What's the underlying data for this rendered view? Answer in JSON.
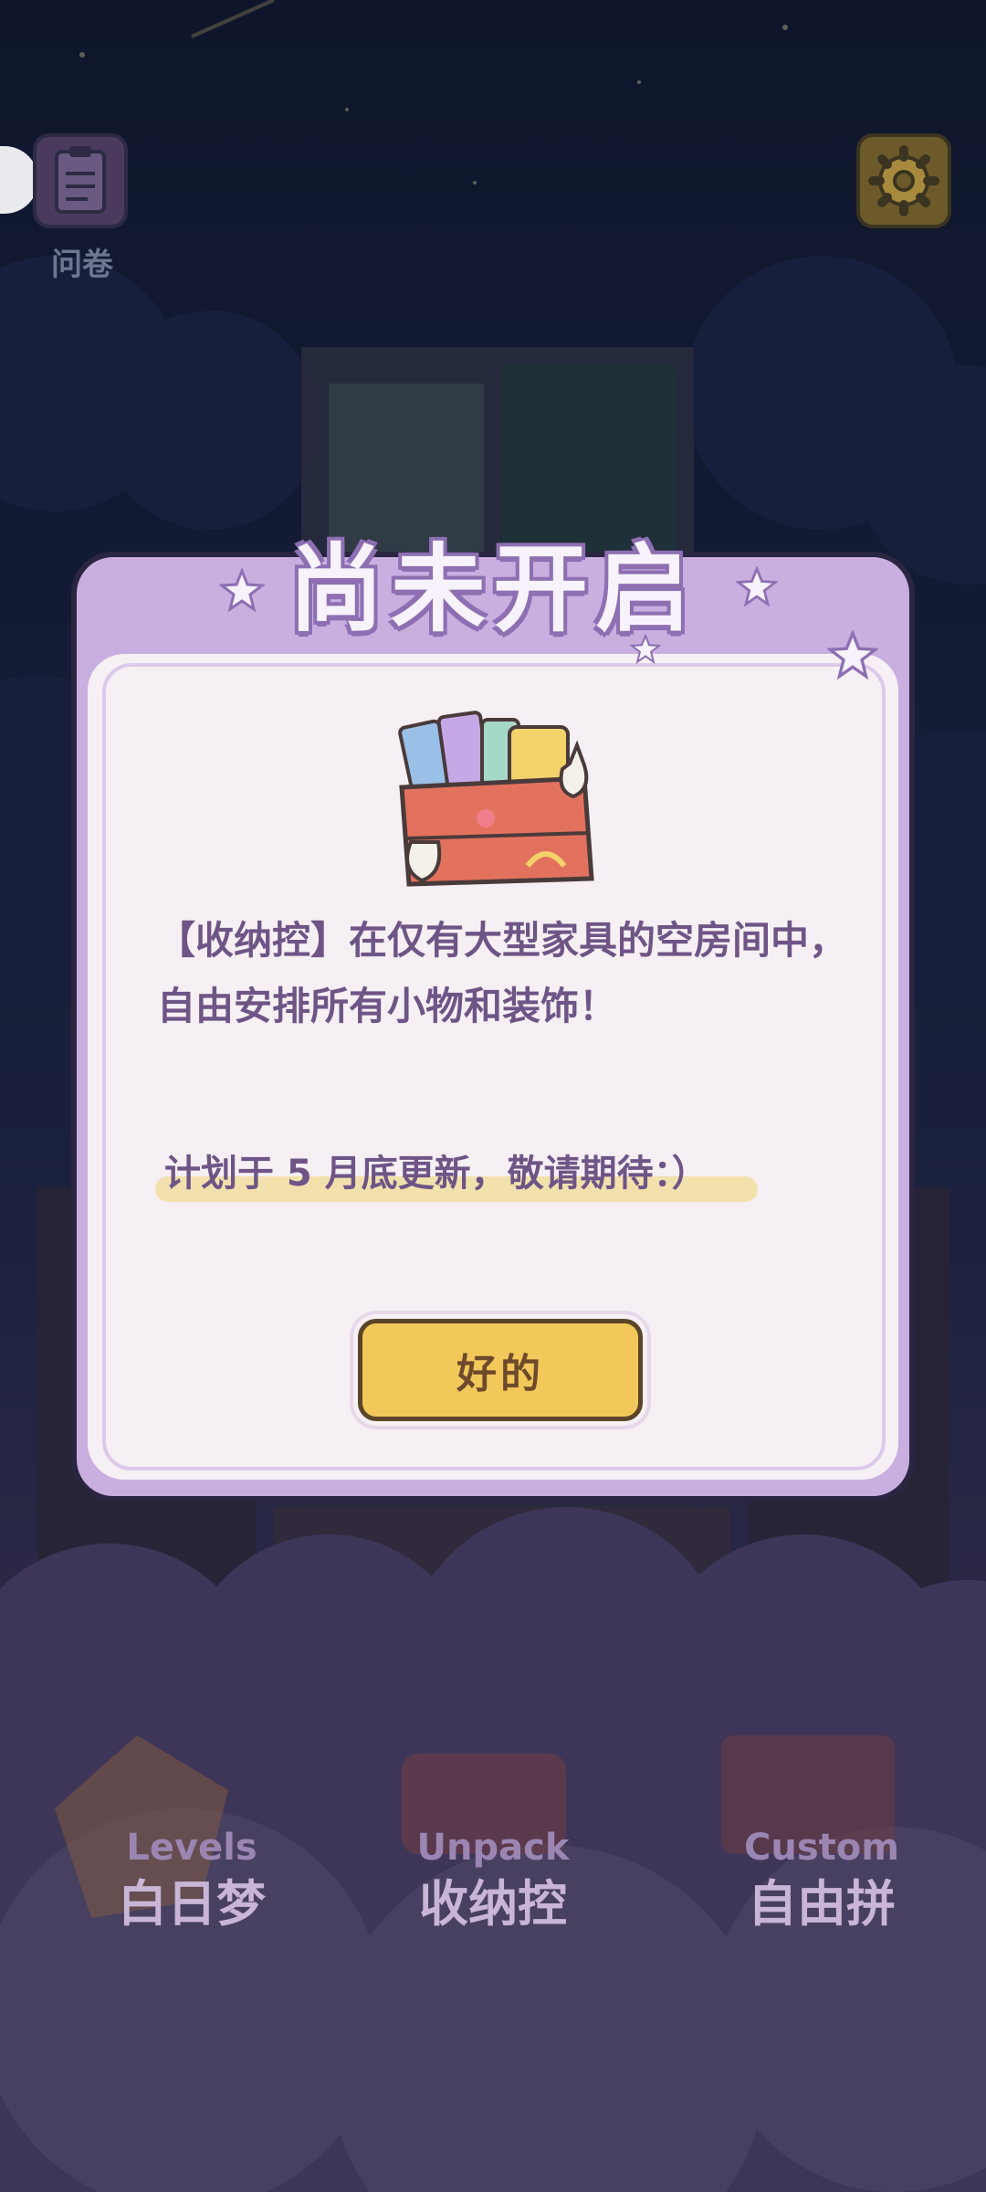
{
  "header": {
    "survey_label": "问卷",
    "survey_icon": "clipboard-icon",
    "settings_icon": "gear-icon"
  },
  "dialog": {
    "title": "尚未开启",
    "description": "【收纳控】在仅有大型家具的空房间中，自由安排所有小物和装饰！",
    "plan": "计划于 5 月底更新，敬请期待：）",
    "ok_label": "好的",
    "illustration": "storage-box-books"
  },
  "modes": [
    {
      "en": "Levels",
      "zh": "白日梦"
    },
    {
      "en": "Unpack",
      "zh": "收纳控"
    },
    {
      "en": "Custom",
      "zh": "自由拼"
    }
  ],
  "colors": {
    "dialog_frame": "#c9aee0",
    "dialog_body": "#f6f0f4",
    "text": "#6e5586",
    "button": "#f2c85a"
  }
}
